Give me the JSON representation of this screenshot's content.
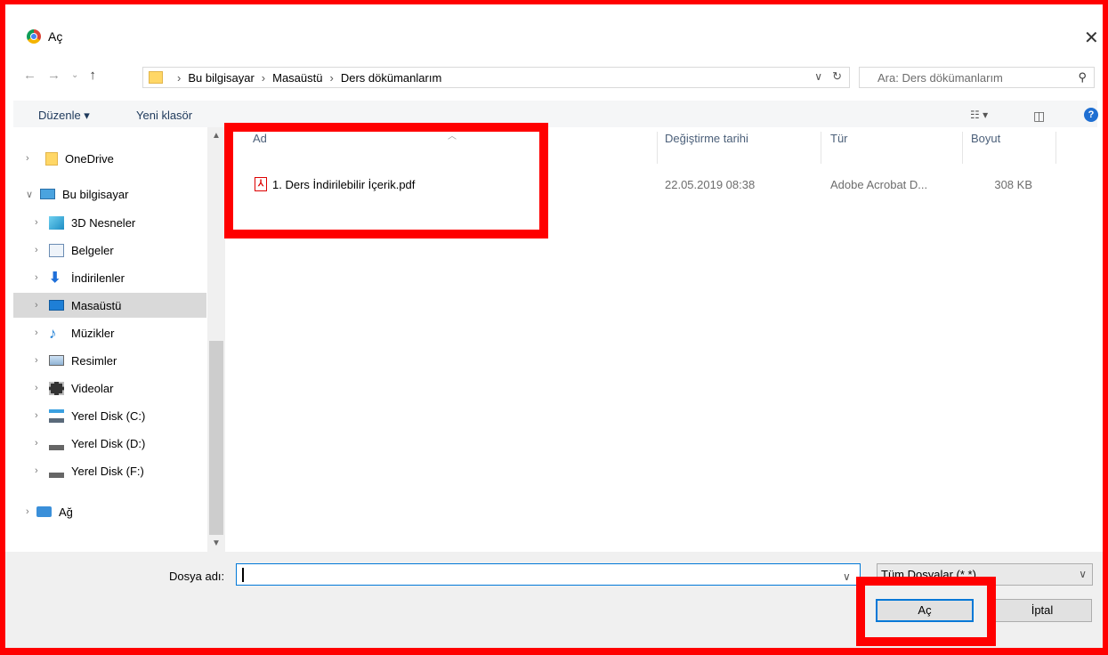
{
  "window": {
    "title": "Aç"
  },
  "address": {
    "crumbs": [
      "Bu bilgisayar",
      "Masaüstü",
      "Ders dökümanlarım"
    ]
  },
  "search": {
    "placeholder": "Ara: Ders dökümanlarım"
  },
  "toolbar": {
    "organize": "Düzenle ▾",
    "new_folder": "Yeni klasör"
  },
  "sidebar": {
    "items": [
      {
        "label": "OneDrive",
        "icon": "folder-icon"
      },
      {
        "label": "Bu bilgisayar",
        "icon": "computer-icon"
      },
      {
        "label": "3D Nesneler",
        "icon": "cube-icon"
      },
      {
        "label": "Belgeler",
        "icon": "documents-icon"
      },
      {
        "label": "İndirilenler",
        "icon": "download-icon"
      },
      {
        "label": "Masaüstü",
        "icon": "desktop-icon"
      },
      {
        "label": "Müzikler",
        "icon": "music-icon"
      },
      {
        "label": "Resimler",
        "icon": "pictures-icon"
      },
      {
        "label": "Videolar",
        "icon": "video-icon"
      },
      {
        "label": "Yerel Disk (C:)",
        "icon": "drive-icon"
      },
      {
        "label": "Yerel Disk (D:)",
        "icon": "drive-icon"
      },
      {
        "label": "Yerel Disk (F:)",
        "icon": "drive-icon"
      },
      {
        "label": "Ağ",
        "icon": "network-icon"
      }
    ]
  },
  "columns": {
    "name": "Ad",
    "date": "Değiştirme tarihi",
    "type": "Tür",
    "size": "Boyut"
  },
  "files": [
    {
      "name": "1. Ders İndirilebilir İçerik.pdf",
      "date": "22.05.2019 08:38",
      "type": "Adobe Acrobat D...",
      "size": "308 KB"
    }
  ],
  "footer": {
    "filename_label": "Dosya adı:",
    "filename_value": "",
    "filetype": "Tüm Dosyalar (*.*)",
    "open": "Aç",
    "cancel": "İptal"
  },
  "colors": {
    "highlight": "#ff0000",
    "accent": "#0078d7"
  }
}
